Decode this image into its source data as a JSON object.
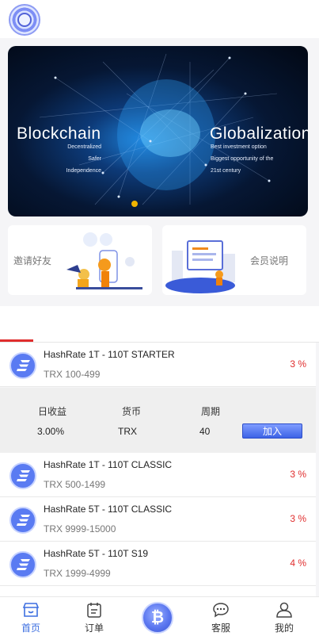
{
  "header": {
    "logo_icon": "shield-coin-logo-icon"
  },
  "banner": {
    "left_title": "Blockchain",
    "left_lines": [
      "Decentralized",
      "Safer",
      "Independence"
    ],
    "right_title": "Globalization",
    "right_lines": [
      "Best investment option",
      "Biggest opportunity of the",
      "21st century"
    ]
  },
  "cards": {
    "invite_label": "邀请好友",
    "member_label": "会员说明"
  },
  "plans": [
    {
      "name": "HashRate 1T - 110T STARTER",
      "range": "TRX 100-499",
      "rate": "3 %"
    },
    {
      "name": "HashRate 1T - 110T CLASSIC",
      "range": "TRX 500-1499",
      "rate": "3 %"
    },
    {
      "name": "HashRate 5T - 110T CLASSIC",
      "range": "TRX 9999-15000",
      "rate": "3 %"
    },
    {
      "name": "HashRate 5T - 110T S19",
      "range": "TRX 1999-4999",
      "rate": "4 %"
    }
  ],
  "detail": {
    "headers": [
      "日收益",
      "货币",
      "周期"
    ],
    "values": [
      "3.00%",
      "TRX",
      "40"
    ],
    "join_label": "加入"
  },
  "tabbar": {
    "home": "首页",
    "orders": "订单",
    "center_icon": "bitcoin-icon",
    "service": "客服",
    "mine": "我的"
  },
  "colors": {
    "accent": "#3d6fe0",
    "rate_red": "#e02e2e",
    "button_blue": "#3d63e6"
  }
}
